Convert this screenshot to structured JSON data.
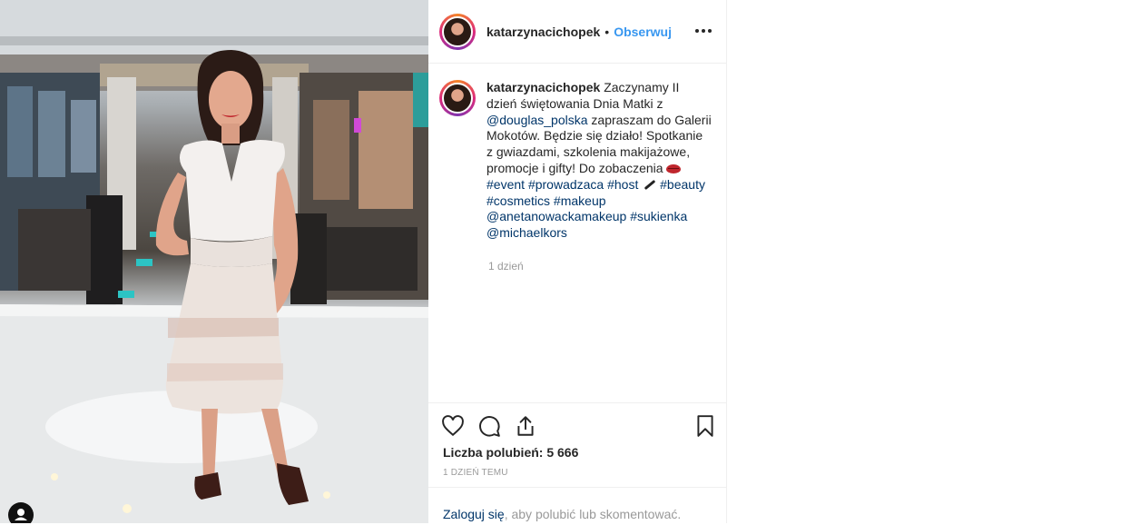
{
  "post": {
    "username": "katarzynacichopek",
    "separator": "•",
    "follow_label": "Obserwuj",
    "more_icon": "ellipsis-icon",
    "caption": {
      "username": "katarzynacichopek",
      "text_1": "Zaczynamy II dzień świętowania Dnia Matki z",
      "mention_1": "@douglas_polska",
      "text_2": "zapraszam do Galerii Mokotów. Będzie się działo! Spotkanie z gwiazdami, szkolenia makijażowe, promocje i gifty! Do zobaczenia",
      "hashtag_event": "#event",
      "hashtag_prowadzaca": "#prowadzaca",
      "hashtag_host": "#host",
      "hashtag_beauty": "#beauty",
      "hashtag_cosmetics": "#cosmetics",
      "hashtag_makeup": "#makeup",
      "mention_2": "@anetanowackamakeup",
      "hashtag_sukienka": "#sukienka",
      "mention_3": "@michaelkors",
      "time": "1 dzień"
    },
    "likes_label": "Liczba polubień: 5 666",
    "timestamp": "1 DZIEŃ TEMU",
    "login": {
      "link": "Zaloguj się",
      "text": ", aby polubić lub skomentować."
    }
  },
  "colors": {
    "link": "#003569",
    "follow": "#3897f0",
    "muted": "#999999",
    "text": "#262626"
  }
}
